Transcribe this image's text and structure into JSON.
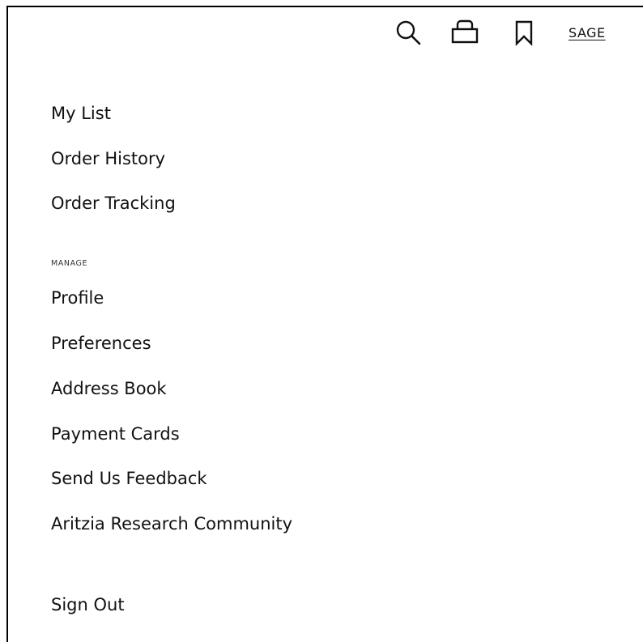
{
  "header": {
    "icons": {
      "search": "search-icon",
      "bag": "shopping-bag-icon",
      "bookmark": "bookmark-icon"
    },
    "account_label": "SAGE"
  },
  "menu": {
    "primary_items": [
      {
        "label": "My List"
      },
      {
        "label": "Order History"
      },
      {
        "label": "Order Tracking"
      }
    ],
    "manage_section": {
      "label": "MANAGE",
      "items": [
        {
          "label": "Profile"
        },
        {
          "label": "Preferences"
        },
        {
          "label": "Address Book"
        },
        {
          "label": "Payment Cards"
        },
        {
          "label": "Send Us Feedback"
        },
        {
          "label": "Aritzia Research Community"
        }
      ]
    },
    "sign_out_label": "Sign Out"
  },
  "colors": {
    "text": "#111111",
    "background": "#ffffff",
    "border": "#000000"
  }
}
